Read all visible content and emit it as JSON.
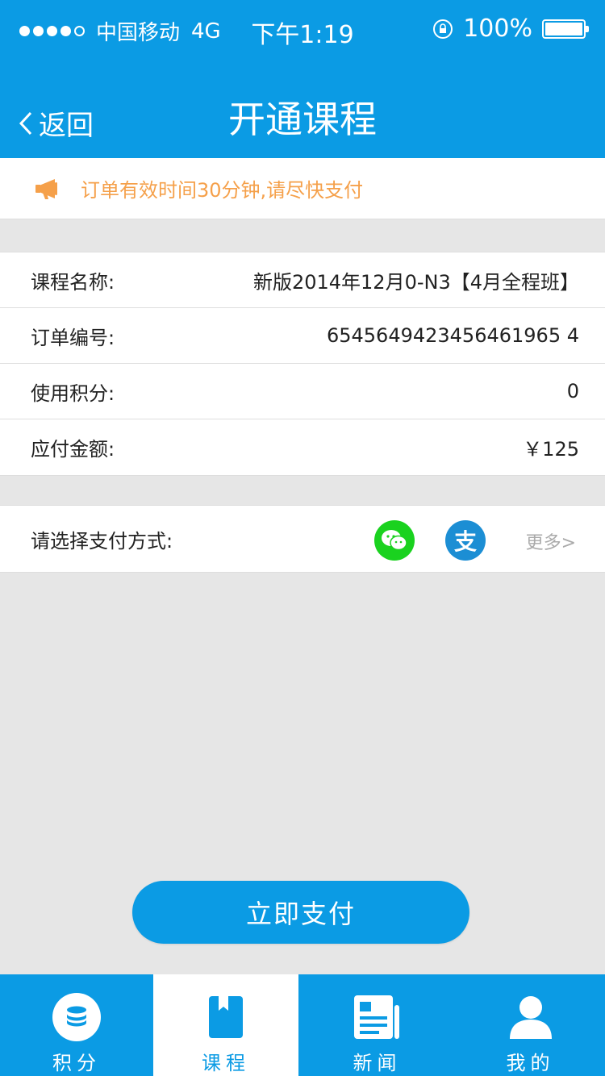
{
  "status_bar": {
    "carrier": "中国移动",
    "network": "4G",
    "time": "下午1:19",
    "battery": "100%"
  },
  "nav": {
    "back_label": "返回",
    "title": "开通课程"
  },
  "notice": {
    "text": "订单有效时间30分钟,请尽快支付"
  },
  "order": {
    "course_label": "课程名称:",
    "course_value": "新版2014年12月0-N3【4月全程班】",
    "order_no_label": "订单编号:",
    "order_no_value": "6545649423456461965 4",
    "points_label": "使用积分:",
    "points_value": "0",
    "amount_label": "应付金额:",
    "amount_value": "￥125"
  },
  "payment": {
    "label": "请选择支付方式:",
    "alipay_glyph": "支",
    "more": "更多>"
  },
  "pay_button": "立即支付",
  "tabs": [
    {
      "label": "积分",
      "icon": "coins-icon"
    },
    {
      "label": "课程",
      "icon": "book-icon"
    },
    {
      "label": "新闻",
      "icon": "newspaper-icon"
    },
    {
      "label": "我的",
      "icon": "user-icon"
    }
  ],
  "colors": {
    "primary": "#0b9be4",
    "notice": "#f5a04a",
    "wechat": "#1ad21f",
    "alipay": "#1c8ed4"
  }
}
